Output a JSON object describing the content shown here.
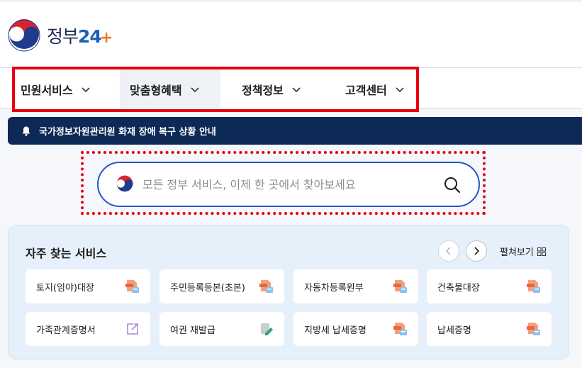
{
  "brand": {
    "name": "정부",
    "num": "24",
    "plus": "+"
  },
  "nav": [
    {
      "label": "민원서비스"
    },
    {
      "label": "맞춤형혜택"
    },
    {
      "label": "정책정보"
    },
    {
      "label": "고객센터"
    }
  ],
  "notice": {
    "text": "국가정보자원관리원 화재 장애 복구 상황 안내"
  },
  "search": {
    "placeholder": "모든 정부 서비스, 이제 한 곳에서 찾아보세요",
    "value": ""
  },
  "frequent": {
    "title": "자주 찾는 서비스",
    "expand_label": "펼쳐보기",
    "items": [
      {
        "label": "토지(임야)대장",
        "icon": "pdf-doc-icon"
      },
      {
        "label": "주민등록등본(초본)",
        "icon": "pdf-doc-icon"
      },
      {
        "label": "자동차등록원부",
        "icon": "pdf-doc-icon"
      },
      {
        "label": "건축물대장",
        "icon": "pdf-doc-icon"
      },
      {
        "label": "가족관계증명서",
        "icon": "external-link-icon"
      },
      {
        "label": "여권 재발급",
        "icon": "edit-doc-icon"
      },
      {
        "label": "지방세 납세증명",
        "icon": "pdf-doc-icon"
      },
      {
        "label": "납세증명",
        "icon": "pdf-doc-icon"
      }
    ]
  },
  "colors": {
    "primary": "#2157c4",
    "notice_bg": "#0c2a55",
    "highlight": "#e60012",
    "panel_bg": "#e6f0fa"
  }
}
